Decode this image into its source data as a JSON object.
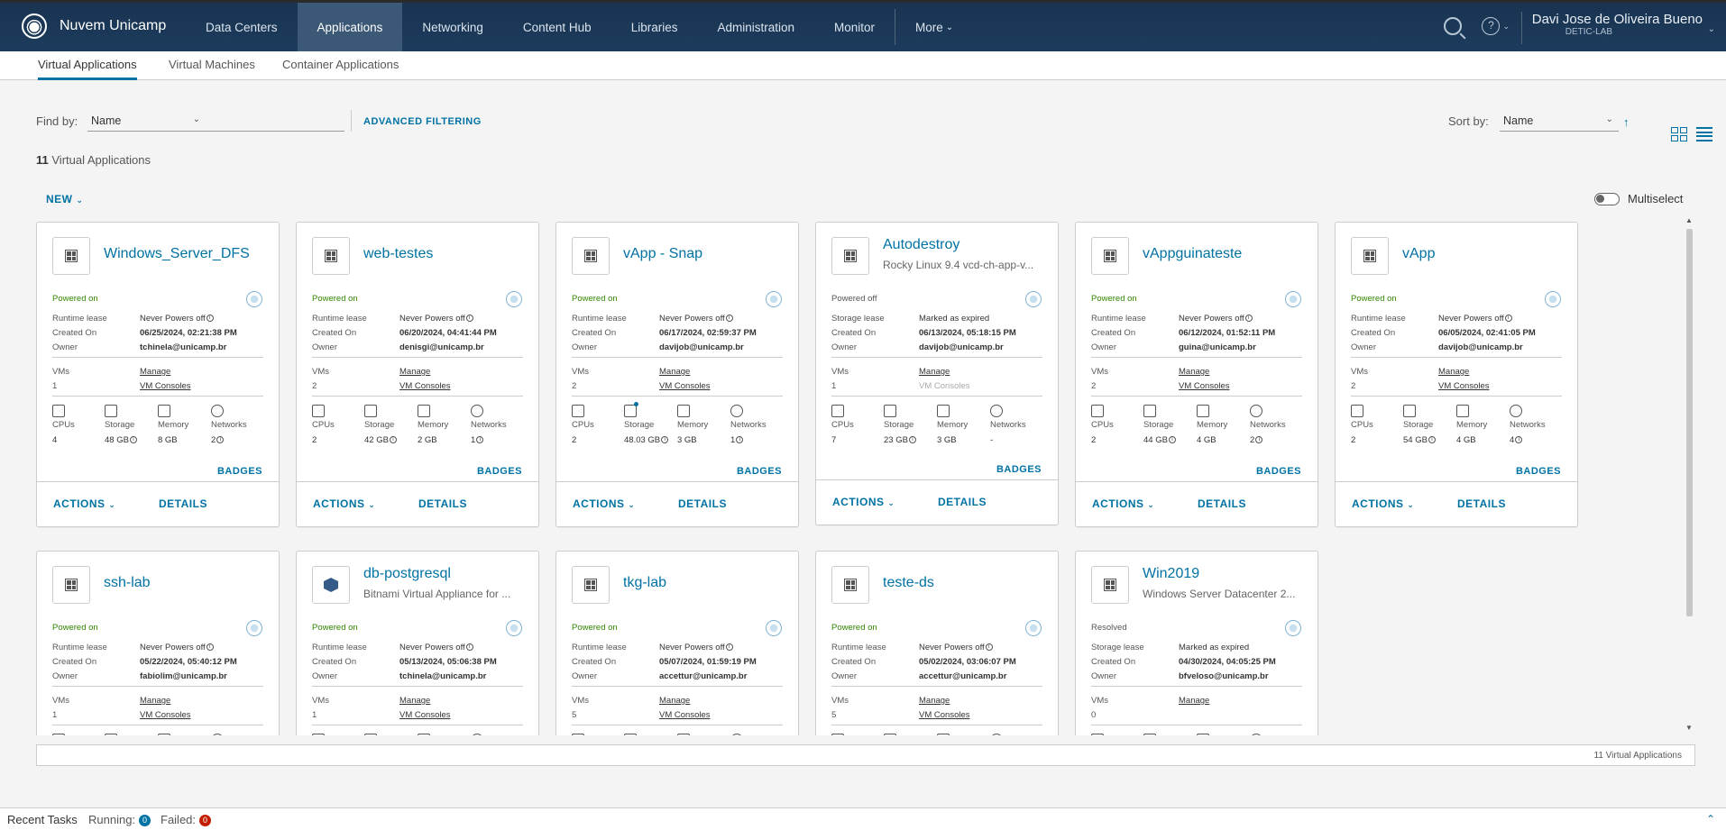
{
  "header": {
    "brand": "Nuvem Unicamp",
    "nav": [
      "Data Centers",
      "Applications",
      "Networking",
      "Content Hub",
      "Libraries",
      "Administration",
      "Monitor"
    ],
    "more": "More",
    "help_icon": "help-icon",
    "user_name": "Davi Jose de Oliveira Bueno",
    "user_org": "DETIC-LAB"
  },
  "subtabs": [
    "Virtual Applications",
    "Virtual Machines",
    "Container Applications"
  ],
  "filter": {
    "find_by_label": "Find by:",
    "find_by_value": "Name",
    "advanced": "ADVANCED FILTERING",
    "sort_by_label": "Sort by:",
    "sort_by_value": "Name"
  },
  "count": {
    "num": "11",
    "label": "Virtual Applications"
  },
  "new_button": "NEW",
  "multiselect": "Multiselect",
  "labels": {
    "runtime_lease": "Runtime lease",
    "storage_lease": "Storage lease",
    "created_on": "Created On",
    "owner": "Owner",
    "vms": "VMs",
    "manage": "Manage",
    "vm_consoles": "VM Consoles",
    "cpus": "CPUs",
    "storage": "Storage",
    "memory": "Memory",
    "networks": "Networks",
    "badges": "BADGES",
    "actions": "ACTIONS",
    "details": "DETAILS"
  },
  "cards": [
    {
      "name": "Windows_Server_DFS",
      "desc": "",
      "status": "Powered on",
      "lease_label": "Runtime lease",
      "lease": "Never Powers off",
      "created": "06/25/2024, 02:21:38 PM",
      "owner": "tchinela@unicamp.br",
      "vms": "1",
      "consoles_enabled": true,
      "cpus": "4",
      "storage": "48 GB",
      "memory": "8 GB",
      "networks": "2"
    },
    {
      "name": "web-testes",
      "desc": "",
      "status": "Powered on",
      "lease_label": "Runtime lease",
      "lease": "Never Powers off",
      "created": "06/20/2024, 04:41:44 PM",
      "owner": "denisgi@unicamp.br",
      "vms": "2",
      "consoles_enabled": true,
      "cpus": "2",
      "storage": "42 GB",
      "memory": "2 GB",
      "networks": "1"
    },
    {
      "name": "vApp - Snap",
      "desc": "",
      "status": "Powered on",
      "lease_label": "Runtime lease",
      "lease": "Never Powers off",
      "created": "06/17/2024, 02:59:37 PM",
      "owner": "davijob@unicamp.br",
      "vms": "2",
      "consoles_enabled": true,
      "cpus": "2",
      "storage": "48.03 GB",
      "memory": "3 GB",
      "networks": "1"
    },
    {
      "name": "Autodestroy",
      "desc": "Rocky Linux 9.4 vcd-ch-app-v...",
      "status": "Powered off",
      "lease_label": "Storage lease",
      "lease": "Marked as expired",
      "created": "06/13/2024, 05:18:15 PM",
      "owner": "davijob@unicamp.br",
      "vms": "1",
      "consoles_enabled": false,
      "cpus": "7",
      "storage": "23 GB",
      "memory": "3 GB",
      "networks": "-"
    },
    {
      "name": "vAppguinateste",
      "desc": "",
      "status": "Powered on",
      "lease_label": "Runtime lease",
      "lease": "Never Powers off",
      "created": "06/12/2024, 01:52:11 PM",
      "owner": "guina@unicamp.br",
      "vms": "2",
      "consoles_enabled": true,
      "cpus": "2",
      "storage": "44 GB",
      "memory": "4 GB",
      "networks": "2"
    },
    {
      "name": "vApp",
      "desc": "",
      "status": "Powered on",
      "lease_label": "Runtime lease",
      "lease": "Never Powers off",
      "created": "06/05/2024, 02:41:05 PM",
      "owner": "davijob@unicamp.br",
      "vms": "2",
      "consoles_enabled": true,
      "cpus": "2",
      "storage": "54 GB",
      "memory": "4 GB",
      "networks": "4"
    },
    {
      "name": "ssh-lab",
      "desc": "",
      "status": "Powered on",
      "lease_label": "Runtime lease",
      "lease": "Never Powers off",
      "created": "05/22/2024, 05:40:12 PM",
      "owner": "fabiolim@unicamp.br",
      "vms": "1",
      "consoles_enabled": true
    },
    {
      "name": "db-postgresql",
      "desc": "Bitnami Virtual Appliance for ...",
      "status": "Powered on",
      "lease_label": "Runtime lease",
      "lease": "Never Powers off",
      "created": "05/13/2024, 05:06:38 PM",
      "owner": "tchinela@unicamp.br",
      "vms": "1",
      "consoles_enabled": true
    },
    {
      "name": "tkg-lab",
      "desc": "",
      "status": "Powered on",
      "lease_label": "Runtime lease",
      "lease": "Never Powers off",
      "created": "05/07/2024, 01:59:19 PM",
      "owner": "accettur@unicamp.br",
      "vms": "5",
      "consoles_enabled": true
    },
    {
      "name": "teste-ds",
      "desc": "",
      "status": "Powered on",
      "lease_label": "Runtime lease",
      "lease": "Never Powers off",
      "created": "05/02/2024, 03:06:07 PM",
      "owner": "accettur@unicamp.br",
      "vms": "5",
      "consoles_enabled": true
    },
    {
      "name": "Win2019",
      "desc": "Windows Server Datacenter 2...",
      "status": "Resolved",
      "lease_label": "Storage lease",
      "lease": "Marked as expired",
      "created": "04/30/2024, 04:05:25 PM",
      "owner": "bfveloso@unicamp.br",
      "vms": "0",
      "consoles_enabled": false
    }
  ],
  "footer_count": "11 Virtual Applications",
  "tasks": {
    "recent": "Recent Tasks",
    "running_label": "Running:",
    "running": "0",
    "failed_label": "Failed:",
    "failed": "0"
  }
}
